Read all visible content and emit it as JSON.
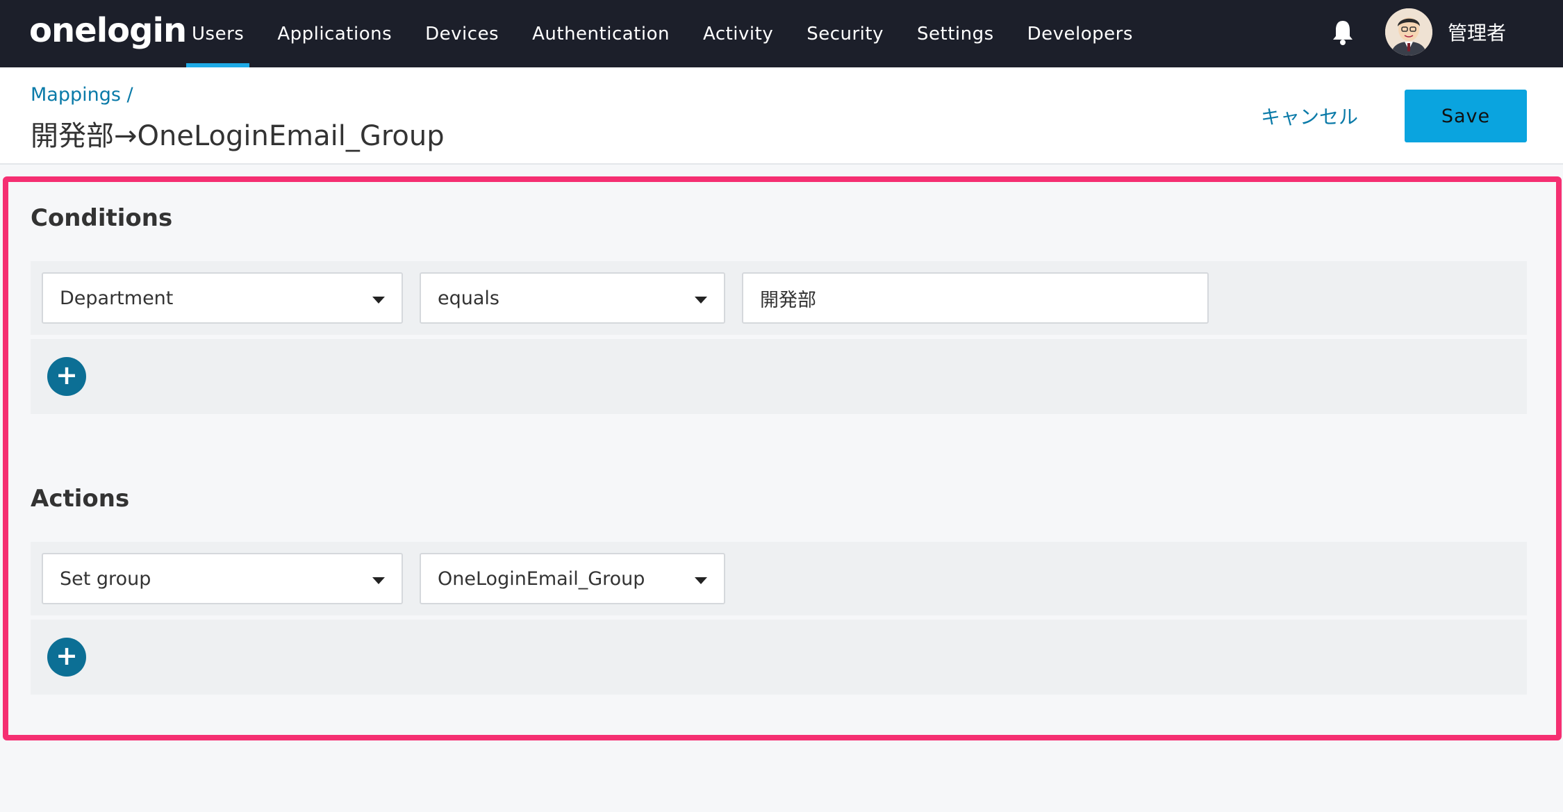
{
  "app": {
    "logo": "onelogin"
  },
  "nav": {
    "items": [
      {
        "label": "Users",
        "active": true
      },
      {
        "label": "Applications"
      },
      {
        "label": "Devices"
      },
      {
        "label": "Authentication"
      },
      {
        "label": "Activity"
      },
      {
        "label": "Security"
      },
      {
        "label": "Settings"
      },
      {
        "label": "Developers"
      }
    ],
    "user_name": "管理者",
    "bell_icon": "bell-icon"
  },
  "header": {
    "breadcrumb": "Mappings /",
    "title": "開発部→OneLoginEmail_Group",
    "cancel_label": "キャンセル",
    "save_label": "Save"
  },
  "conditions": {
    "title": "Conditions",
    "row": {
      "field": "Department",
      "operator": "equals",
      "value": "開発部"
    },
    "add_label": "+"
  },
  "actions": {
    "title": "Actions",
    "row": {
      "action": "Set group",
      "value": "OneLoginEmail_Group"
    },
    "add_label": "+"
  },
  "colors": {
    "accent": "#0aa4df",
    "nav_bg": "#1c1f2a",
    "highlight": "#f52f72",
    "add_button": "#0c6f95",
    "link": "#0a7aa8"
  }
}
